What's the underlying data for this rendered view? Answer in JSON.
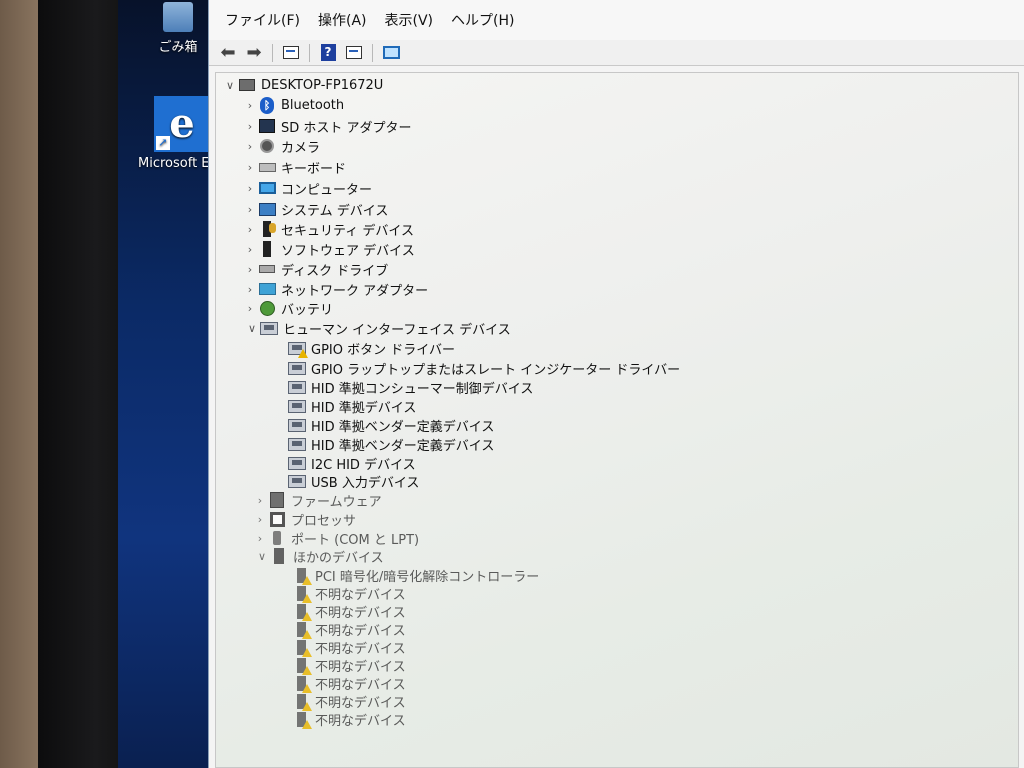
{
  "desktop": {
    "recycle_bin_label": "ごみ箱",
    "edge_label": "Microsoft Ed"
  },
  "menu": [
    "ファイル(F)",
    "操作(A)",
    "表示(V)",
    "ヘルプ(H)"
  ],
  "tree": {
    "root": "DESKTOP-FP1672U",
    "top_categories": [
      {
        "label": "Bluetooth",
        "icon": "bluetooth-icon"
      },
      {
        "label": "SD ホスト アダプター",
        "icon": "sd-host-icon"
      },
      {
        "label": "カメラ",
        "icon": "camera-icon"
      },
      {
        "label": "キーボード",
        "icon": "keyboard-icon"
      },
      {
        "label": "コンピューター",
        "icon": "computer-icon"
      },
      {
        "label": "システム デバイス",
        "icon": "system-device-icon"
      },
      {
        "label": "セキュリティ デバイス",
        "icon": "security-device-icon"
      },
      {
        "label": "ソフトウェア デバイス",
        "icon": "software-device-icon"
      },
      {
        "label": "ディスク ドライブ",
        "icon": "disk-drive-icon"
      },
      {
        "label": "ネットワーク アダプター",
        "icon": "network-adapter-icon"
      },
      {
        "label": "バッテリ",
        "icon": "battery-icon"
      }
    ],
    "hid_category": "ヒューマン インターフェイス デバイス",
    "hid_children": [
      {
        "label": "GPIO ボタン ドライバー",
        "warning": true
      },
      {
        "label": "GPIO ラップトップまたはスレート インジケーター ドライバー",
        "warning": false
      },
      {
        "label": "HID 準拠コンシューマー制御デバイス",
        "warning": false
      },
      {
        "label": "HID 準拠デバイス",
        "warning": false
      },
      {
        "label": "HID 準拠ベンダー定義デバイス",
        "warning": false
      },
      {
        "label": "HID 準拠ベンダー定義デバイス",
        "warning": false
      },
      {
        "label": "I2C HID デバイス",
        "warning": false
      },
      {
        "label": "USB 入力デバイス",
        "warning": false
      }
    ],
    "lower_categories": [
      {
        "label": "ファームウェア",
        "icon": "firmware-icon"
      },
      {
        "label": "プロセッサ",
        "icon": "processor-icon"
      },
      {
        "label": "ポート (COM と LPT)",
        "icon": "port-icon"
      }
    ],
    "other_category": "ほかのデバイス",
    "other_children": [
      "PCI 暗号化/暗号化解除コントローラー",
      "不明なデバイス",
      "不明なデバイス",
      "不明なデバイス",
      "不明なデバイス",
      "不明なデバイス",
      "不明なデバイス",
      "不明なデバイス",
      "不明なデバイス"
    ]
  }
}
